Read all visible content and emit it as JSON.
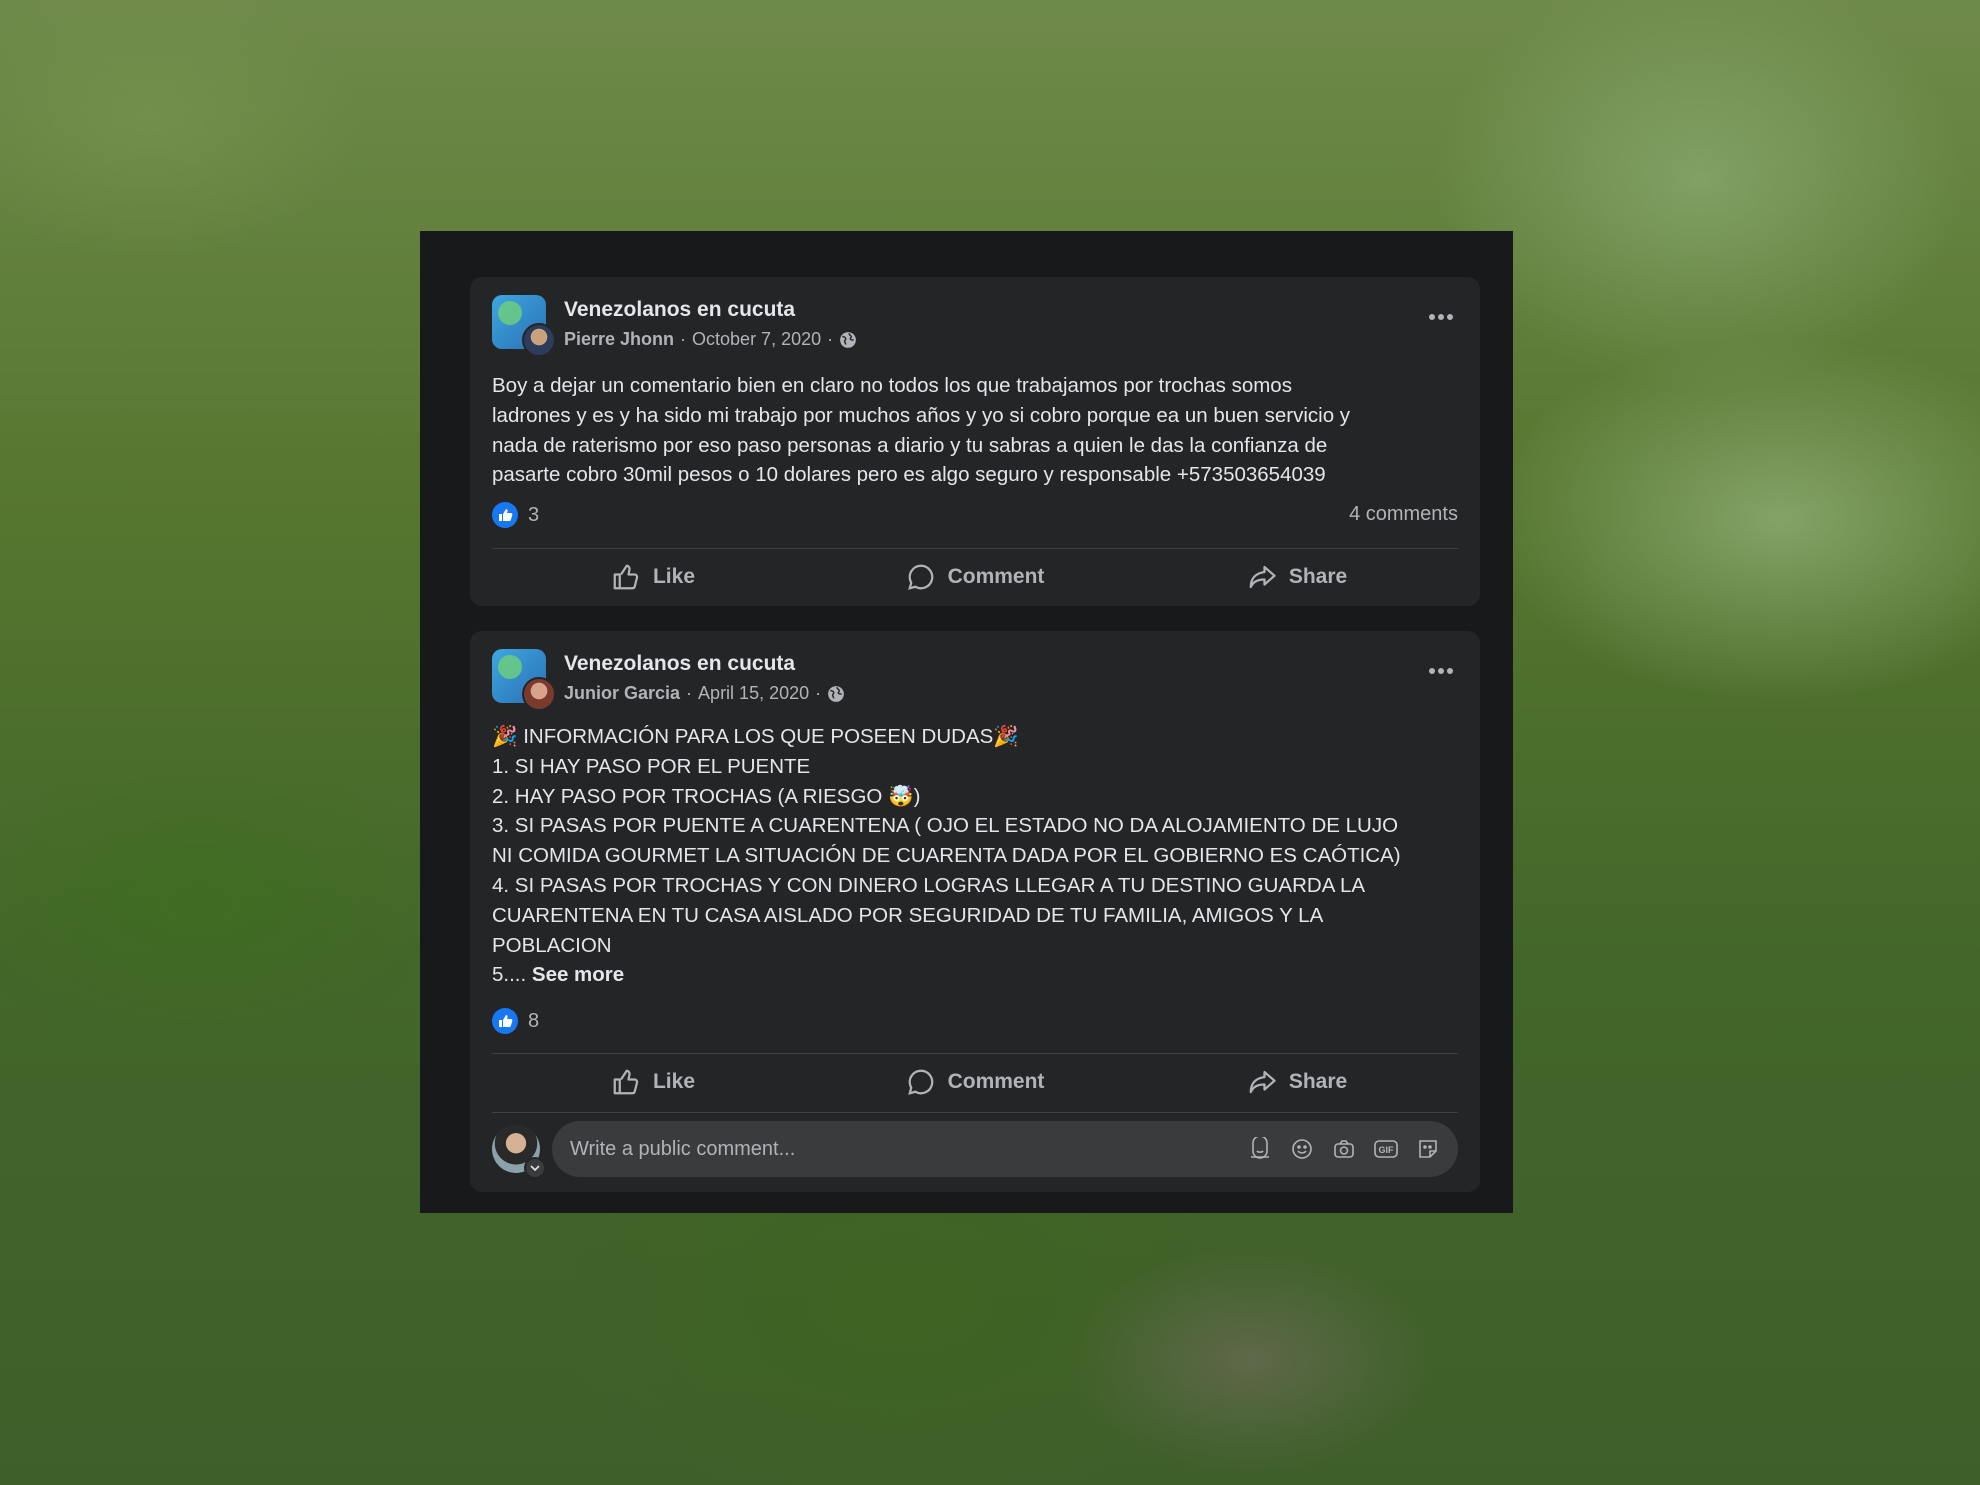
{
  "posts": [
    {
      "group_name": "Venezolanos en cucuta",
      "author": "Pierre Jhonn",
      "date": "October 7, 2020",
      "separator": "·",
      "text_lines": [
        "Boy a dejar un comentario bien en claro no todos los que trabajamos por trochas somos",
        "ladrones y es y ha sido mi trabajo por muchos años y yo si cobro porque ea un buen servicio y",
        "nada de raterismo por eso paso personas a diario y tu sabras a quien le das la confianza de",
        "pasarte cobro 30mil pesos o 10 dolares pero es algo seguro y responsable +573503654039"
      ],
      "reaction_count": "3",
      "comments_count": "4 comments",
      "actions": {
        "like": "Like",
        "comment": "Comment",
        "share": "Share"
      }
    },
    {
      "group_name": "Venezolanos en cucuta",
      "author": "Junior Garcia",
      "date": "April 15, 2020",
      "separator": "·",
      "text_lines": [
        "🎉 INFORMACIÓN PARA LOS QUE POSEEN DUDAS🎉",
        "1. SI HAY PASO POR EL PUENTE",
        "2. HAY PASO POR TROCHAS (A RIESGO 🤯)",
        "3. SI PASAS POR PUENTE A CUARENTENA ( OJO EL ESTADO NO DA ALOJAMIENTO DE LUJO",
        "NI COMIDA GOURMET LA SITUACIÓN DE CUARENTA DADA POR EL GOBIERNO ES CAÓTICA)",
        "4. SI PASAS POR TROCHAS Y CON DINERO LOGRAS LLEGAR A TU DESTINO GUARDA LA",
        "CUARENTENA EN TU CASA AISLADO POR SEGURIDAD DE TU FAMILIA, AMIGOS Y LA",
        "POBLACION"
      ],
      "last_line_prefix": "5.... ",
      "see_more": "See more",
      "reaction_count": "8",
      "actions": {
        "like": "Like",
        "comment": "Comment",
        "share": "Share"
      }
    }
  ],
  "comment_box": {
    "placeholder": "Write a public comment...",
    "icons": [
      "avatar-sticker-icon",
      "emoji-icon",
      "camera-icon",
      "gif-icon",
      "sticker-icon"
    ],
    "gif_label": "GIF"
  },
  "colors": {
    "panel": "#18191a",
    "card": "#242526",
    "text_primary": "#e4e6eb",
    "text_secondary": "#b0b3b8",
    "like_blue": "#1877f2"
  }
}
